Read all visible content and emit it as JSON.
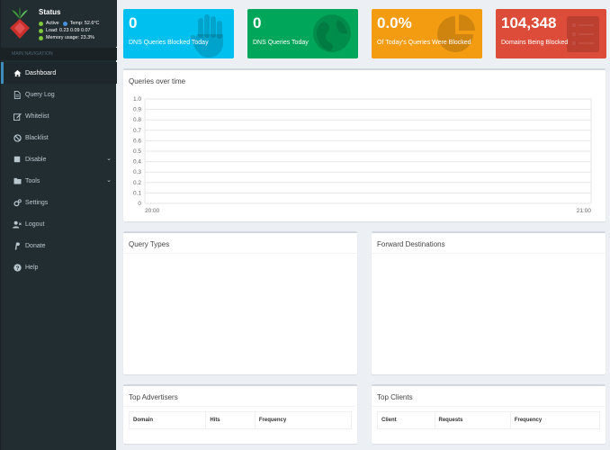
{
  "sidebar": {
    "status_title": "Status",
    "status_active": "Active",
    "status_temp": "Temp: 52.6°C",
    "status_load": "Load:  0.23  0.09  0.07",
    "status_memory": "Memory usage:  23.3%",
    "nav_header": "MAIN NAVIGATION",
    "items": [
      {
        "label": "Dashboard",
        "icon": "home-icon"
      },
      {
        "label": "Query Log",
        "icon": "file-icon"
      },
      {
        "label": "Whitelist",
        "icon": "edit-icon"
      },
      {
        "label": "Blacklist",
        "icon": "ban-icon"
      },
      {
        "label": "Disable",
        "icon": "stop-icon"
      },
      {
        "label": "Tools",
        "icon": "folder-icon"
      },
      {
        "label": "Settings",
        "icon": "gears-icon"
      },
      {
        "label": "Logout",
        "icon": "user-times-icon"
      },
      {
        "label": "Donate",
        "icon": "paypal-icon"
      },
      {
        "label": "Help",
        "icon": "question-icon"
      }
    ]
  },
  "stats": [
    {
      "value": "0",
      "label": "DNS Queries Blocked Today",
      "color": "#00c0ef",
      "icon": "hand-icon"
    },
    {
      "value": "0",
      "label": "DNS Queries Today",
      "color": "#00a65a",
      "icon": "globe-icon"
    },
    {
      "value": "0.0%",
      "label": "Of Today's Queries Were Blocked",
      "color": "#f39c12",
      "icon": "pie-chart-icon"
    },
    {
      "value": "104,348",
      "label": "Domains Being Blocked",
      "color": "#dd4b39",
      "icon": "list-icon"
    }
  ],
  "queries_title": "Queries over time",
  "chart_data": {
    "type": "line",
    "title": "Queries over time",
    "x_tick_labels": [
      "20:00",
      "21:00"
    ],
    "y_tick_labels": [
      "0",
      "0.1",
      "0.2",
      "0.3",
      "0.4",
      "0.5",
      "0.6",
      "0.7",
      "0.8",
      "0.9",
      "1.0"
    ],
    "ylim": [
      0,
      1.0
    ],
    "grid": true,
    "series": []
  },
  "query_types_title": "Query Types",
  "forward_title": "Forward Destinations",
  "top_advertisers": {
    "title": "Top Advertisers",
    "columns": [
      "Domain",
      "Hits",
      "Frequency"
    ]
  },
  "top_clients": {
    "title": "Top Clients",
    "columns": [
      "Client",
      "Requests",
      "Frequency"
    ]
  }
}
